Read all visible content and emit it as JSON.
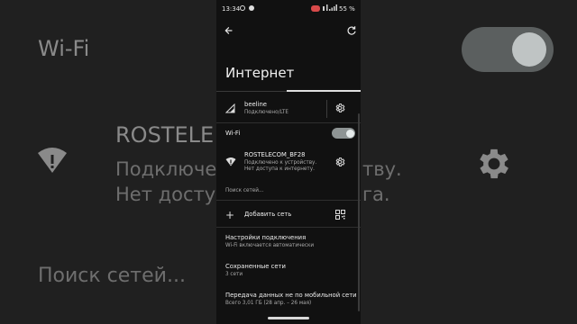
{
  "background": {
    "wifi_title": "Wi-Fi",
    "ssid": "ROSTELE",
    "line1": "Подключе",
    "line1_tail": "тву.",
    "line2": "Нет досту",
    "line2_tail": "га.",
    "search": "Поиск сетей..."
  },
  "status_bar": {
    "time": "13:34",
    "battery": "55 %"
  },
  "title": "Интернет",
  "mobile": {
    "name": "beeline",
    "status": "Подключено/LTE"
  },
  "wifi": {
    "label": "Wi-Fi",
    "enabled": true,
    "network": {
      "ssid": "ROSTELECOM_BF28",
      "status_line1": "Подключено к устройству.",
      "status_line2": "Нет доступа к интернету."
    },
    "searching": "Поиск сетей..."
  },
  "add_network": "Добавить сеть",
  "settings": [
    {
      "title": "Настройки подключения",
      "subtitle": "Wi-Fi включается автоматически"
    },
    {
      "title": "Сохраненные сети",
      "subtitle": "3 сети"
    },
    {
      "title": "Передача данных не по мобильной сети",
      "subtitle": "Всего 3,01 ГБ (28 апр. – 26 мая)"
    }
  ],
  "colors": {
    "accent_toggle": "#8e9494",
    "recording": "#d84a4a"
  },
  "icons": [
    "back-arrow-icon",
    "refresh-icon",
    "signal-icon",
    "gear-icon",
    "wifi-warning-icon",
    "plus-icon",
    "qr-code-icon"
  ]
}
